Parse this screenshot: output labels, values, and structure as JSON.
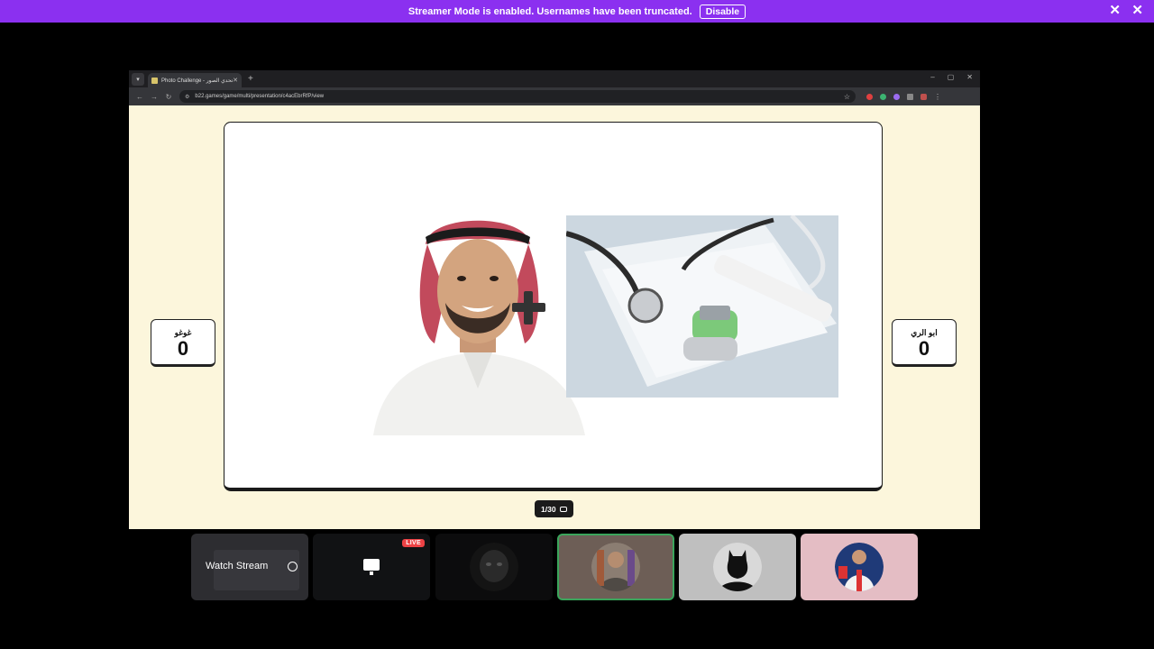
{
  "banner": {
    "message": "Streamer Mode is enabled. Usernames have been truncated.",
    "disable_label": "Disable",
    "close_glyph": "✕"
  },
  "browser": {
    "tab_title": "Photo Challenge - تحدي الصور",
    "new_tab_glyph": "+",
    "url": "b22.games/game/multi/presentation/c4acEbrRfP/view",
    "window_controls": [
      "–",
      "▢",
      "✕"
    ]
  },
  "game": {
    "left_player": {
      "name": "غوغو",
      "score": "0"
    },
    "right_player": {
      "name": "ابو الري",
      "score": "0"
    },
    "progress": "1/30"
  },
  "tiles": {
    "watch_stream_label": "Watch Stream",
    "live_label": "LIVE"
  },
  "colors": {
    "banner": "#8b30f0",
    "page_bg": "#fcf6dc",
    "speaking_border": "#3ba55c",
    "live_badge": "#ed4245"
  }
}
